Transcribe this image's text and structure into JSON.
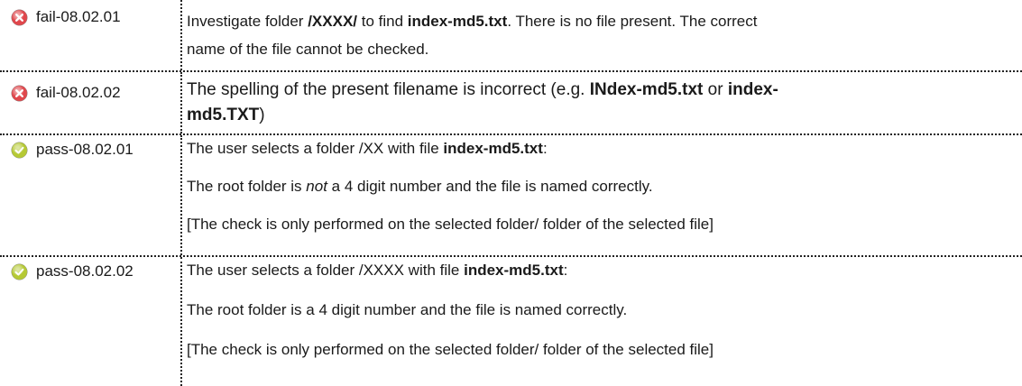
{
  "colors": {
    "fail": "#e0474c",
    "pass": "#b5c934",
    "border": "#222222"
  },
  "rows": [
    {
      "status": "fail",
      "icon": "fail-x-circle-icon",
      "id": "fail-08.02.01",
      "paragraphs": [
        [
          {
            "t": "Investigate folder "
          },
          {
            "t": "/XXXX/",
            "b": true
          },
          {
            "t": " to find "
          },
          {
            "t": "index-md5.txt",
            "b": true
          },
          {
            "t": ". There is no file present. The correct"
          }
        ],
        [
          {
            "t": "name of the file cannot be checked."
          }
        ]
      ]
    },
    {
      "status": "fail",
      "icon": "fail-x-circle-icon",
      "id": "fail-08.02.02",
      "paragraphs": [
        [
          {
            "t": "The spelling of the present filename is incorrect (e.g. "
          },
          {
            "t": "INdex-md5.txt",
            "b": true
          },
          {
            "t": " or "
          },
          {
            "t": "index-",
            "b": true
          }
        ],
        [
          {
            "t": "md5.TXT",
            "b": true
          },
          {
            "t": ")"
          }
        ]
      ]
    },
    {
      "status": "pass",
      "icon": "pass-check-circle-icon",
      "id": "pass-08.02.01",
      "paragraphs": [
        [
          {
            "t": "The user selects a folder /XX with file "
          },
          {
            "t": "index-md5.txt",
            "b": true
          },
          {
            "t": ":"
          }
        ],
        [
          {
            "t": "The root folder is "
          },
          {
            "t": "not",
            "i": true
          },
          {
            "t": " a 4 digit number and the file is named correctly."
          }
        ],
        [
          {
            "t": "[The check is only performed on the selected folder/ folder of the selected file]"
          }
        ]
      ]
    },
    {
      "status": "pass",
      "icon": "pass-check-circle-icon",
      "id": "pass-08.02.02",
      "paragraphs": [
        [
          {
            "t": "The user selects a folder /XXXX with file "
          },
          {
            "t": "index-md5.txt",
            "b": true
          },
          {
            "t": ":"
          }
        ],
        [
          {
            "t": "The root folder is a 4 digit number and the file is named correctly."
          }
        ],
        [
          {
            "t": "[The check is only performed on the selected folder/ folder of the selected file]"
          }
        ]
      ]
    }
  ]
}
